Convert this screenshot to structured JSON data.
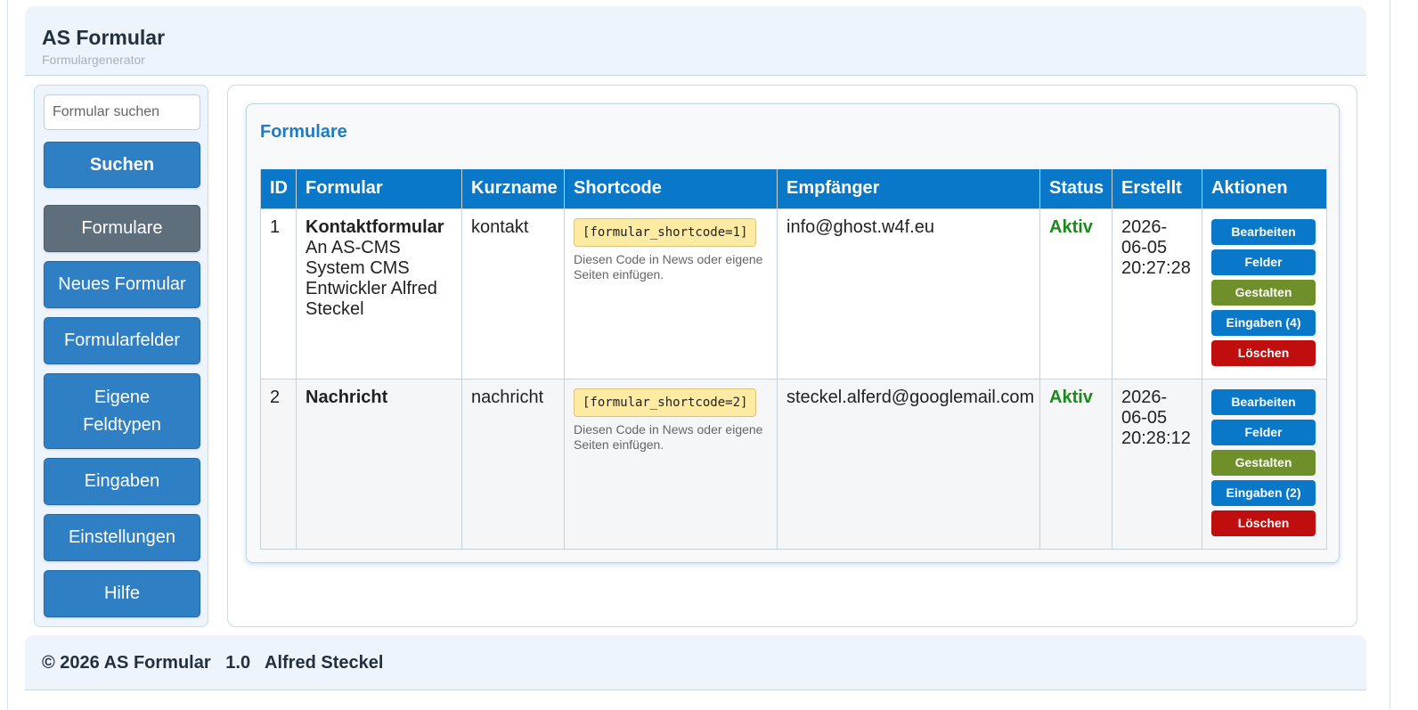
{
  "header": {
    "title": "AS Formular",
    "subtitle": "Formulargenerator"
  },
  "sidebar": {
    "search": {
      "placeholder": "Formular suchen",
      "button": "Suchen"
    },
    "items": [
      {
        "label": "Formulare",
        "active": true
      },
      {
        "label": "Neues Formular"
      },
      {
        "label": "Formularfelder"
      },
      {
        "label": "Eigene Feldtypen"
      },
      {
        "label": "Eingaben"
      },
      {
        "label": "Einstellungen"
      },
      {
        "label": "Hilfe"
      }
    ]
  },
  "main": {
    "title": "Formulare",
    "columns": [
      "ID",
      "Formular",
      "Kurzname",
      "Shortcode",
      "Empfänger",
      "Status",
      "Erstellt",
      "Aktionen"
    ],
    "rows": [
      {
        "id": "1",
        "name": "Kontaktformular",
        "description": "An AS-CMS System CMS Entwickler Alfred Steckel",
        "short": "kontakt",
        "shortcode": "[formular_shortcode=1]",
        "hint": "Diesen Code in News oder eigene Seiten einfügen.",
        "recipient": "info@ghost.w4f.eu",
        "status": "Aktiv",
        "created": "2026-06-05 20:27:28",
        "actions": [
          "Bearbeiten",
          "Felder",
          "Gestalten",
          "Eingaben (4)",
          "Löschen"
        ]
      },
      {
        "id": "2",
        "name": "Nachricht",
        "description": "",
        "short": "nachricht",
        "shortcode": "[formular_shortcode=2]",
        "hint": "Diesen Code in News oder eigene Seiten einfügen.",
        "recipient": "steckel.alferd@googlemail.com",
        "status": "Aktiv",
        "created": "2026-06-05 20:28:12",
        "actions": [
          "Bearbeiten",
          "Felder",
          "Gestalten",
          "Eingaben (2)",
          "Löschen"
        ]
      }
    ]
  },
  "footer": {
    "text": "© 2026 AS Formular   1.0   Alfred Steckel"
  },
  "colors": {
    "primary": "#2f7fc4",
    "table_header": "#0a78c8",
    "active_nav": "#5e6f7b",
    "status_active": "#1b8a1b",
    "action_green": "#6e8f2a",
    "action_red": "#c00d0d"
  }
}
